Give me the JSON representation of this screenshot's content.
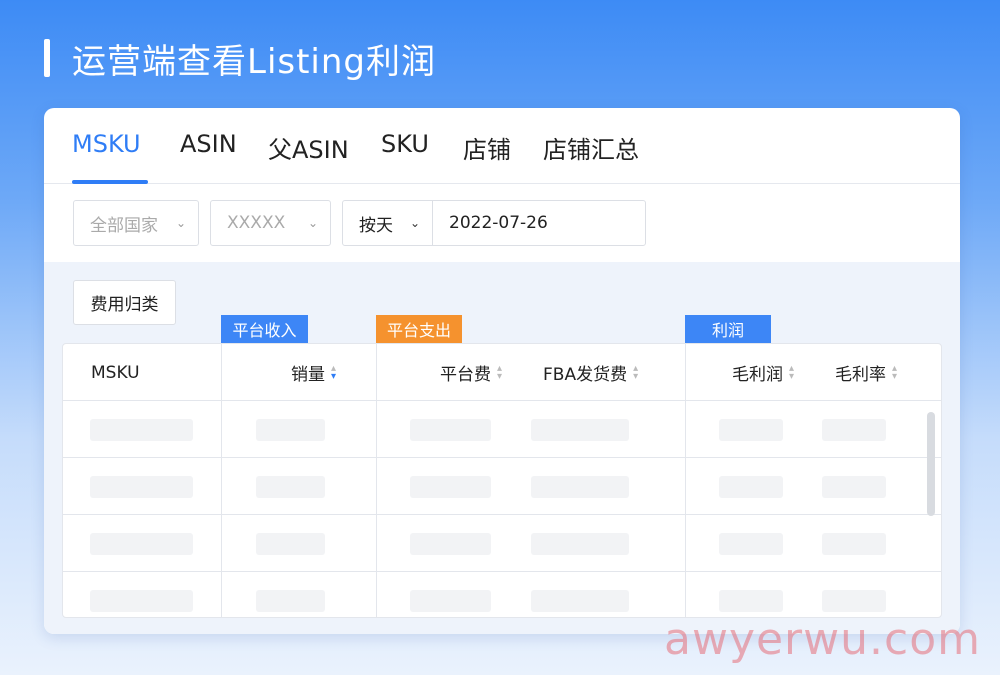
{
  "header": {
    "title": "运营端查看Listing利润"
  },
  "tabs": [
    {
      "label": "MSKU",
      "active": true
    },
    {
      "label": "ASIN"
    },
    {
      "label": "父ASIN"
    },
    {
      "label": "SKU"
    },
    {
      "label": "店铺"
    },
    {
      "label": "店铺汇总"
    }
  ],
  "filters": {
    "country": "全部国家",
    "store": "XXXXX",
    "date_unit": "按天",
    "date": "2022-07-26"
  },
  "toolbar": {
    "fee_category_label": "费用归类"
  },
  "column_groups": {
    "platform_income": "平台收入",
    "platform_expense": "平台支出",
    "profit": "利润"
  },
  "columns": {
    "msku": "MSKU",
    "sales": "销量",
    "platform_fee": "平台费",
    "fba_fee": "FBA发货费",
    "gross_profit": "毛利润",
    "gross_margin": "毛利率"
  },
  "watermark": "awyerwu.com",
  "colors": {
    "accent": "#2f7df6",
    "income_tag": "#3d86f6",
    "expense_tag": "#f5922e",
    "profit_tag": "#3d86f6"
  }
}
